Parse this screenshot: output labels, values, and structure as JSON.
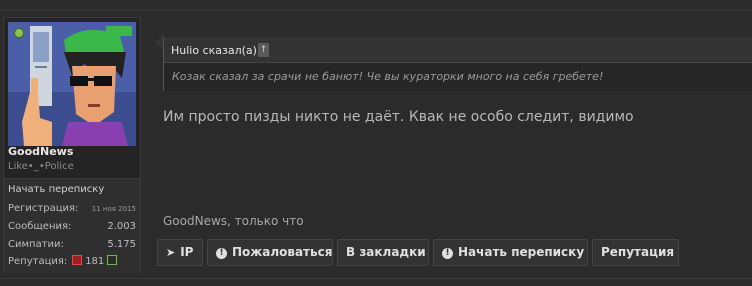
{
  "user": {
    "name": "GoodNews",
    "title": "Like•_•Police",
    "start_conversation": "Начать переписку",
    "stats": [
      {
        "label": "Регистрация:",
        "value": "11 ноя 2015"
      },
      {
        "label": "Сообщения:",
        "value": "2.003"
      },
      {
        "label": "Симпатии:",
        "value": "5.175"
      }
    ],
    "reputation_label": "Репутация:",
    "reputation_value": "181"
  },
  "quote": {
    "author": "Hulio сказал(а):",
    "jump_glyph": "↑",
    "text": "Козак сказал за срачи не банют! Че вы кураторки много на себя гребете!"
  },
  "message": {
    "text": "Им просто пизды никто не даёт. Квак не особо следит, видимо",
    "meta": "GoodNews, только что"
  },
  "actions": {
    "ip": "IP",
    "report": "Пожаловаться",
    "bookmark": "В закладки",
    "start_conversation": "Начать переписку",
    "reputation": "Репутация"
  },
  "colors": {
    "background": "#2b2b2b",
    "rep_minus": "#a02020",
    "rep_plus": "#6fbf3a",
    "online": "#8bc34a"
  }
}
